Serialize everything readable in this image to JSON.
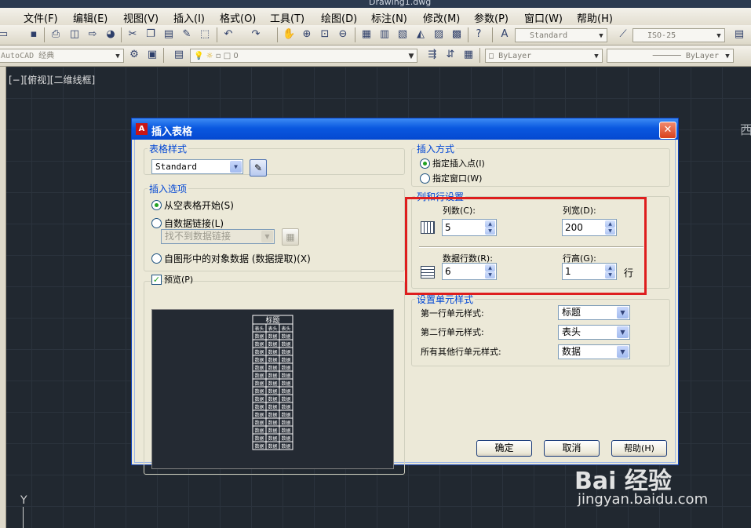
{
  "app": {
    "document_title": "Drawing1.dwg",
    "workspace": "AutoCAD 经典",
    "view_label": "[−][俯视][二维线框]",
    "ucs_axis": "Y",
    "viewcube_label": "西"
  },
  "menu": [
    "文件(F)",
    "编辑(E)",
    "视图(V)",
    "插入(I)",
    "格式(O)",
    "工具(T)",
    "绘图(D)",
    "标注(N)",
    "修改(M)",
    "参数(P)",
    "窗口(W)",
    "帮助(H)"
  ],
  "toolbar": {
    "text_style": "Standard",
    "dim_style": "ISO-25",
    "layer": "0",
    "color": "ByLayer",
    "linetype": "ByLayer"
  },
  "dialog": {
    "title": "插入表格",
    "table_style": {
      "legend": "表格样式",
      "value": "Standard"
    },
    "insert_options": {
      "legend": "插入选项",
      "option_empty": "从空表格开始(S)",
      "option_datalink": "自数据链接(L)",
      "datalink_value": "找不到数据链接",
      "option_extraction": "自图形中的对象数据 (数据提取)(X)",
      "selected": "option_empty"
    },
    "preview": {
      "label": "预览(P)",
      "checked": true,
      "table_title": "标题",
      "header_row": [
        "表头",
        "表头",
        "表头"
      ],
      "data_cell": "数据"
    },
    "insertion_behavior": {
      "legend": "插入方式",
      "option_point": "指定插入点(I)",
      "option_window": "指定窗口(W)",
      "selected": "option_point"
    },
    "column_row_settings": {
      "legend": "列和行设置",
      "columns_label": "列数(C):",
      "columns_value": "5",
      "column_width_label": "列宽(D):",
      "column_width_value": "200",
      "data_rows_label": "数据行数(R):",
      "data_rows_value": "6",
      "row_height_label": "行高(G):",
      "row_height_value": "1",
      "row_height_unit": "行"
    },
    "cell_styles": {
      "legend": "设置单元样式",
      "first_row_label": "第一行单元样式:",
      "first_row_value": "标题",
      "second_row_label": "第二行单元样式:",
      "second_row_value": "表头",
      "other_rows_label": "所有其他行单元样式:",
      "other_rows_value": "数据"
    },
    "buttons": {
      "ok": "确定",
      "cancel": "取消",
      "help": "帮助(H)"
    }
  },
  "watermark": {
    "brand": "Bai 经验",
    "url": "jingyan.baidu.com"
  },
  "colors": {
    "dialog_bg": "#ece9d8",
    "title_bar": "#0a58e0",
    "group_legend": "#0046d5",
    "highlight": "#de1e1e",
    "canvas": "#212830"
  }
}
